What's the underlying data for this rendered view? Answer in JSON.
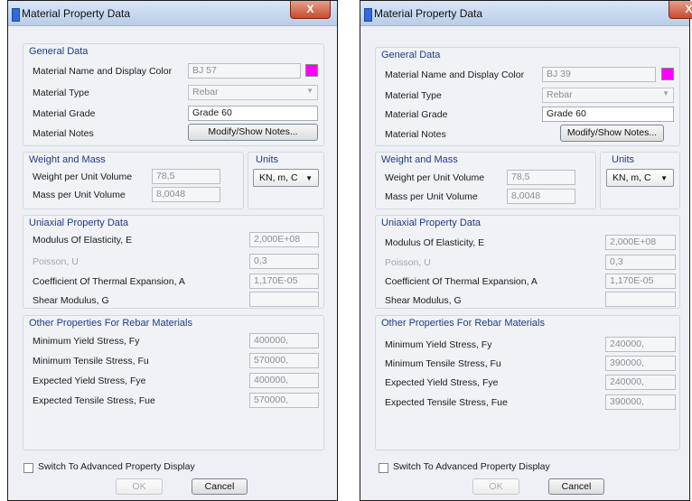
{
  "dialog_title": "Material Property Data",
  "close_glyph": "X",
  "labels": {
    "general": "General Data",
    "name_color": "Material Name and Display Color",
    "type": "Material Type",
    "grade": "Material Grade",
    "notes": "Material Notes",
    "notes_button": "Modify/Show Notes...",
    "weight_mass": "Weight and Mass",
    "weight": "Weight per Unit Volume",
    "mass": "Mass per Unit Volume",
    "units": "Units",
    "uniaxial": "Uniaxial Property Data",
    "modulus": "Modulus Of Elasticity,  E",
    "poisson": "Poisson,  U",
    "thermal": "Coefficient Of Thermal Expansion,  A",
    "shear": "Shear Modulus,  G",
    "rebar": "Other Properties For Rebar Materials",
    "fy": "Minimum Yield Stress,  Fy",
    "fu": "Minimum Tensile Stress,  Fu",
    "fye": "Expected Yield Stress,  Fye",
    "fue": "Expected Tensile Stress,  Fue",
    "advanced": "Switch To Advanced Property Display",
    "ok": "OK",
    "cancel": "Cancel"
  },
  "dialogs": [
    {
      "material_name": "BJ 57",
      "display_color": "#ff00ff",
      "material_type": "Rebar",
      "grade": "Grade 60",
      "weight": "78,5",
      "mass": "8,0048",
      "units": "KN, m, C",
      "modulus": "2,000E+08",
      "poisson": "0,3",
      "thermal": "1,170E-05",
      "shear": "",
      "fy": "400000,",
      "fu": "570000,",
      "fye": "400000,",
      "fue": "570000,"
    },
    {
      "material_name": "BJ 39",
      "display_color": "#ff00ff",
      "material_type": "Rebar",
      "grade": "Grade 60",
      "weight": "78,5",
      "mass": "8,0048",
      "units": "KN, m, C",
      "modulus": "2,000E+08",
      "poisson": "0,3",
      "thermal": "1,170E-05",
      "shear": "",
      "fy": "240000,",
      "fu": "390000,",
      "fye": "240000,",
      "fue": "390000,"
    }
  ]
}
